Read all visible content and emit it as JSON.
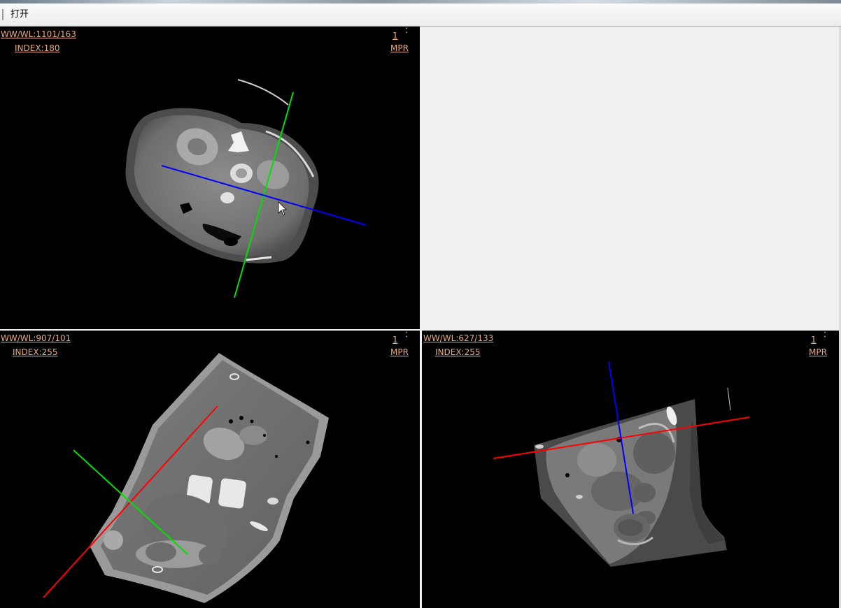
{
  "toolbar": {
    "open_label": "打开"
  },
  "views": {
    "axial": {
      "ww_wl": "WW/WL:1101/163",
      "index": "INDEX:180",
      "slice": "1",
      "mode": "MPR"
    },
    "coronal": {
      "ww_wl": "WW/WL:907/101",
      "index": "INDEX:255",
      "slice": "1",
      "mode": "MPR"
    },
    "sagittal": {
      "ww_wl": "WW/WL:627/133",
      "index": "INDEX:255",
      "slice": "1",
      "mode": "MPR"
    }
  },
  "colors": {
    "overlay_text": "#e7a97e",
    "crosshair_green": "#00e000",
    "crosshair_blue": "#0000ff",
    "crosshair_red": "#ff0000",
    "viewport_bg": "#000000",
    "panel_bg": "#f0f0f0"
  },
  "icons": {
    "spinner": "up-down-arrows-icon",
    "cursor": "mouse-pointer-icon",
    "grip": "toolbar-grip-icon"
  }
}
